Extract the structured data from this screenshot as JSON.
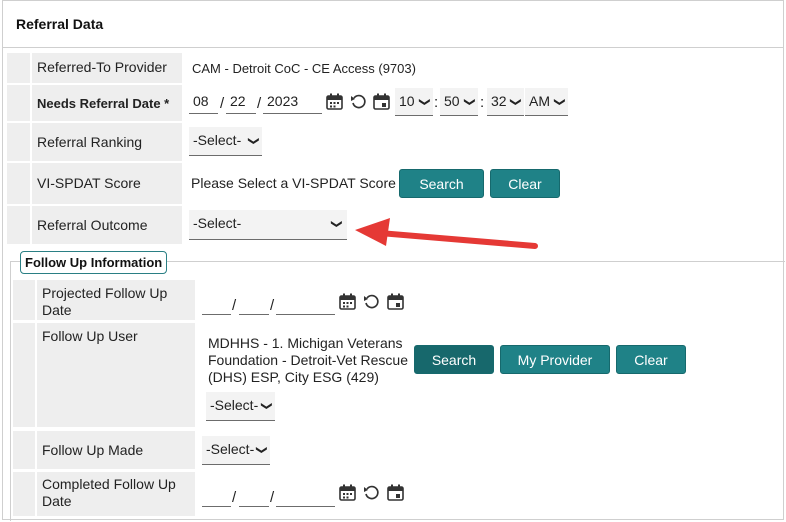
{
  "header": {
    "title": "Referral Data"
  },
  "referral": {
    "referred_to_label": "Referred-To Provider",
    "referred_to_value": "CAM - Detroit CoC - CE Access (9703)",
    "needs_date_label": "Needs Referral Date *",
    "date_month": "08",
    "date_day": "22",
    "date_year": "2023",
    "hour": "10",
    "minute": "50",
    "second": "32",
    "ampm": "AM",
    "ranking_label": "Referral Ranking",
    "ranking_value": "-Select-",
    "vispdat_label": "VI-SPDAT Score",
    "vispdat_value": "Please Select a VI-SPDAT Score",
    "search_label": "Search",
    "clear_label": "Clear",
    "outcome_label": "Referral Outcome",
    "outcome_value": "-Select-"
  },
  "follow_up": {
    "legend": "Follow Up Information",
    "projected_label_1": "Projected Follow Up",
    "projected_label_2": "Date",
    "user_label": "Follow Up User",
    "user_line_1": "MDHHS - 1. Michigan Veterans",
    "user_line_2": "Foundation - Detroit-Vet Rescue",
    "user_line_3": "(DHS) ESP, City ESG (429)",
    "user_select": "-Select-",
    "search_label": "Search",
    "my_provider_label": "My Provider",
    "clear_label": "Clear",
    "made_label": "Follow Up Made",
    "made_value": "-Select-",
    "completed_label_1": "Completed Follow Up",
    "completed_label_2": "Date"
  },
  "colors": {
    "button": "#1f8287",
    "arrow": "#e53935",
    "cell": "#eeeeee"
  },
  "icons": [
    "calendar-icon",
    "reset-icon",
    "today-icon",
    "chevron-down-icon",
    "arrow-annotation"
  ]
}
